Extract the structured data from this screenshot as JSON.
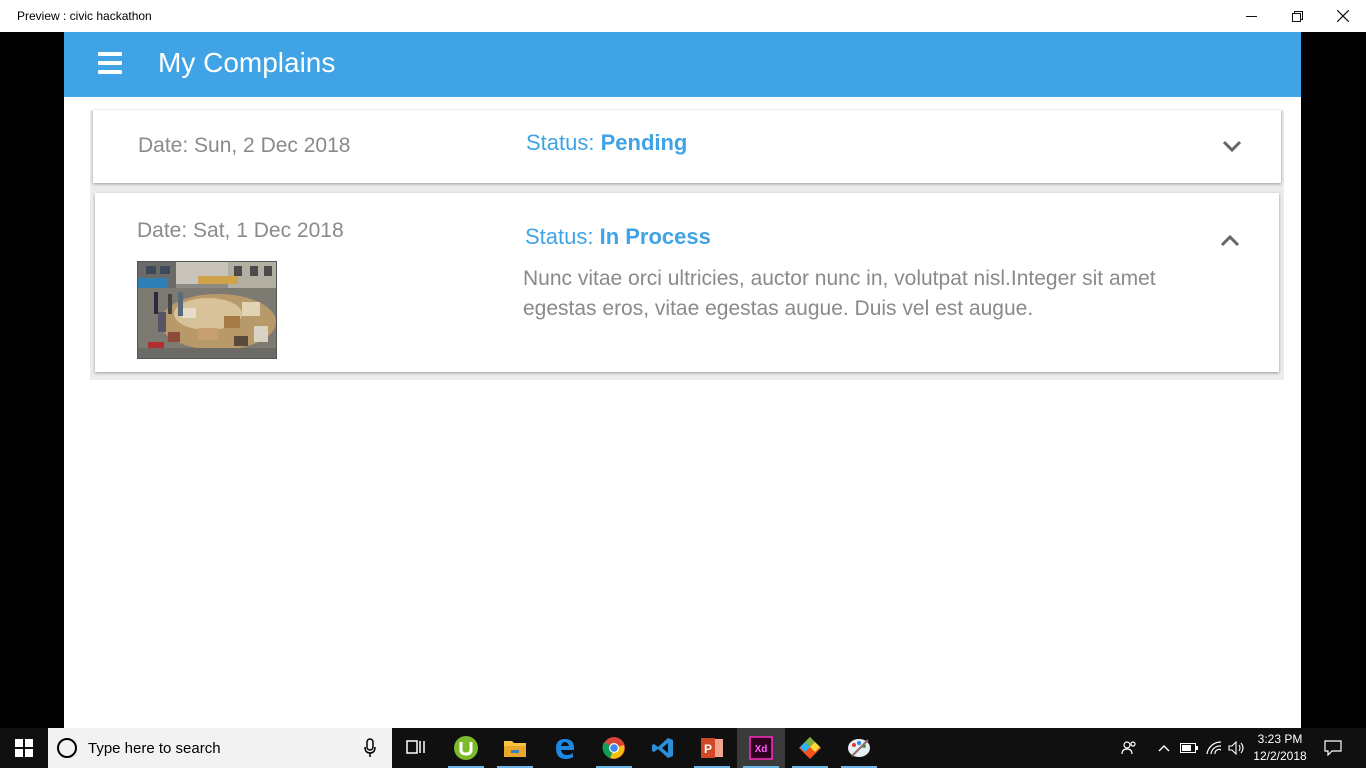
{
  "window": {
    "title": "Preview : civic hackathon"
  },
  "appbar": {
    "title": "My Complains"
  },
  "complaints": [
    {
      "date": "Date: Sun, 2 Dec 2018",
      "status_label": "Status: ",
      "status_value": "Pending",
      "expanded": false
    },
    {
      "date": "Date: Sat, 1 Dec 2018",
      "status_label": "Status: ",
      "status_value": "In Process",
      "expanded": true,
      "description": "Nunc vitae orci ultricies, auctor nunc in, volutpat nisl.Integer sit amet egestas eros, vitae egestas augue. Duis vel est augue."
    }
  ],
  "taskbar": {
    "search_placeholder": "Type here to search",
    "clock_time": "3:23 PM",
    "clock_date": "12/2/2018",
    "pinned_apps": [
      "task-view",
      "utorrent",
      "file-explorer",
      "edge",
      "chrome",
      "vscode",
      "powerpoint",
      "adobe-xd",
      "git",
      "paint"
    ]
  },
  "colors": {
    "accent": "#3fa3e6",
    "text_muted": "#8a8a8a"
  }
}
